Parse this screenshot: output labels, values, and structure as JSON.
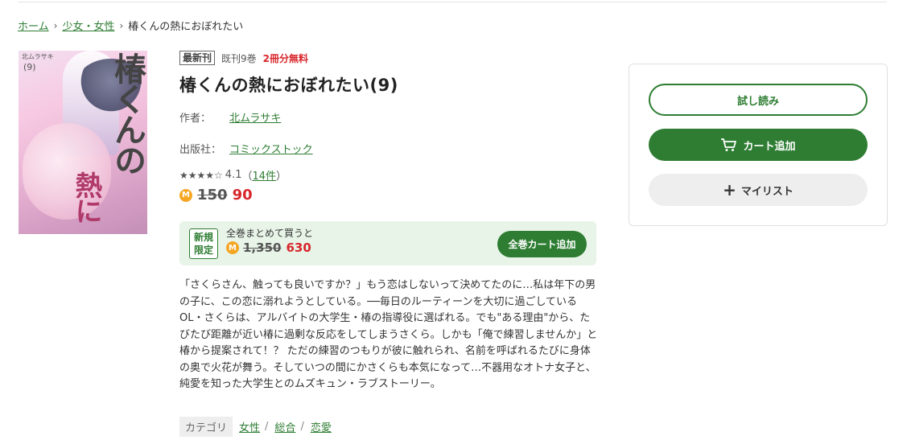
{
  "breadcrumb": {
    "home": "ホーム",
    "category": "少女・女性",
    "current": "椿くんの熱におぼれたい"
  },
  "cover": {
    "title_vertical": "椿くんの",
    "title_vertical2": "熱に",
    "volume": "(9)",
    "author": "北ムラサキ"
  },
  "badges": {
    "latest": "最新刊",
    "published": "既刊9巻",
    "free": "2冊分無料"
  },
  "title": "椿くんの熱におぼれたい(9)",
  "author": {
    "label": "作者：",
    "name": "北ムラサキ"
  },
  "publisher": {
    "label": "出版社：",
    "name": "コミックストック"
  },
  "rating": {
    "stars": "★★★★☆",
    "score": "4.1",
    "reviews_open": "（",
    "reviews": "14件",
    "reviews_close": "）"
  },
  "price": {
    "coin_symbol": "M",
    "original": "150",
    "sale": "90"
  },
  "bundle": {
    "tag_line1": "新規",
    "tag_line2": "限定",
    "description": "全巻まとめて買うと",
    "original": "1,350",
    "sale": "630",
    "button": "全巻カート追加"
  },
  "description": "「さくらさん、触っても良いですか？」もう恋はしないって決めてたのに…私は年下の男の子に、この恋に溺れようとしている。──毎日のルーティーンを大切に過ごしているOL・さくらは、アルバイトの大学生・椿の指導役に選ばれる。でも\"ある理由\"から、たびたび距離が近い椿に過剰な反応をしてしまうさくら。しかも「俺で練習しませんか」と椿から提案されて！？ ただの練習のつもりが彼に触れられ、名前を呼ばれるたびに身体の奥で火花が舞う。そしていつの間にかさくらも本気になって…不器用なオトナ女子と、純愛を知った大学生とのムズキュン・ラブストーリー。",
  "category": {
    "label": "カテゴリ",
    "items": [
      "女性",
      "総合",
      "恋愛"
    ],
    "separator": "/"
  },
  "actions": {
    "trial": "試し読み",
    "cart": "カート追加",
    "mylist": "マイリスト"
  },
  "colors": {
    "accent": "#2e7d32",
    "sale": "#d8262b",
    "bundle_bg": "#e8f4e8",
    "coin": "#f5a623"
  }
}
